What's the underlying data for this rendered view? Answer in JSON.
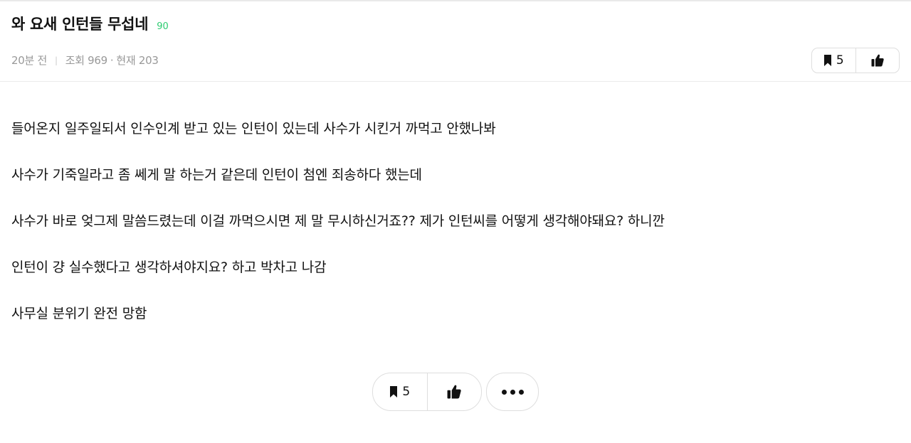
{
  "post": {
    "title": "와 요새 인턴들 무섭네",
    "comment_count": "90",
    "time_ago": "20분 전",
    "views": "조회 969",
    "current": "현재 203"
  },
  "actions": {
    "scrap_count": "5",
    "scrap_icon": "bookmark-icon",
    "like_icon": "thumbs-up-icon",
    "more_icon": "more-dots-icon"
  },
  "body": {
    "paragraphs": [
      "들어온지 일주일되서 인수인계 받고 있는 인턴이 있는데 사수가 시킨거 까먹고 안했나봐",
      "사수가 기죽일라고 좀 쎄게 말 하는거 같은데 인턴이 첨엔 죄송하다 했는데",
      "사수가 바로 엊그제 말씀드렸는데 이걸 까먹으시면 제 말 무시하신거죠?? 제가 인턴씨를 어떻게 생각해야돼요? 하니깐",
      "인턴이 걍 실수했다고 생각하셔야지요? 하고 박차고 나감",
      "사무실 분위기 완전 망함"
    ]
  },
  "colors": {
    "comment_count": "#2ecc71",
    "meta_text": "#999999",
    "border": "#dedede"
  }
}
